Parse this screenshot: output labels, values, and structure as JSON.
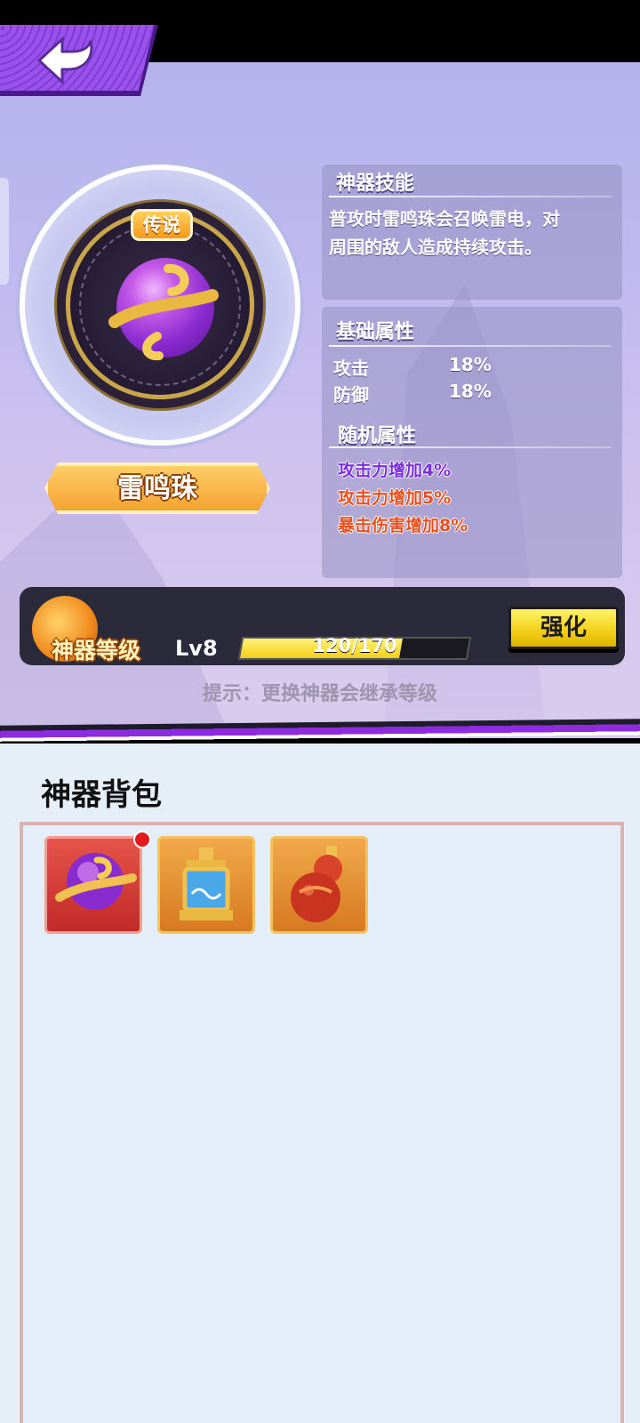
{
  "nav": {
    "back_icon": "back-arrow-icon"
  },
  "artifact": {
    "rarity": "传说",
    "name": "雷鸣珠",
    "icon": "thunder-orb-icon"
  },
  "skill_panel": {
    "title": "神器技能",
    "description_line1": "普攻时雷鸣珠会召唤雷电，对",
    "description_line2": "周围的敌人造成持续攻击。"
  },
  "base_attributes": {
    "title": "基础属性",
    "rows": [
      {
        "label": "攻击",
        "value": "18%"
      },
      {
        "label": "防御",
        "value": "18%"
      }
    ]
  },
  "random_attributes": {
    "title": "随机属性",
    "lines": [
      {
        "text": "攻击力增加4%",
        "color": "#7b2de0"
      },
      {
        "text": "攻击力增加5%",
        "color": "#e8501e"
      },
      {
        "text": "暴击伤害增加8%",
        "color": "#e8501e"
      }
    ]
  },
  "level": {
    "label": "神器等级",
    "value": "Lv8",
    "exp_text": "120/170",
    "exp_fraction": 0.706,
    "enhance_label": "强化"
  },
  "hint": "提示：更换神器会继承等级",
  "bag": {
    "title": "神器背包",
    "items": [
      {
        "icon": "thunder-orb-icon",
        "rarity_color": "red",
        "has_notification": true
      },
      {
        "icon": "seal-lantern-icon",
        "rarity_color": "orange",
        "has_notification": false
      },
      {
        "icon": "gourd-icon",
        "rarity_color": "orange",
        "has_notification": false
      }
    ]
  },
  "colors": {
    "accent_purple": "#8c2be0",
    "enhance_yellow": "#f3cf16",
    "legend_orange": "#f59a1a"
  }
}
